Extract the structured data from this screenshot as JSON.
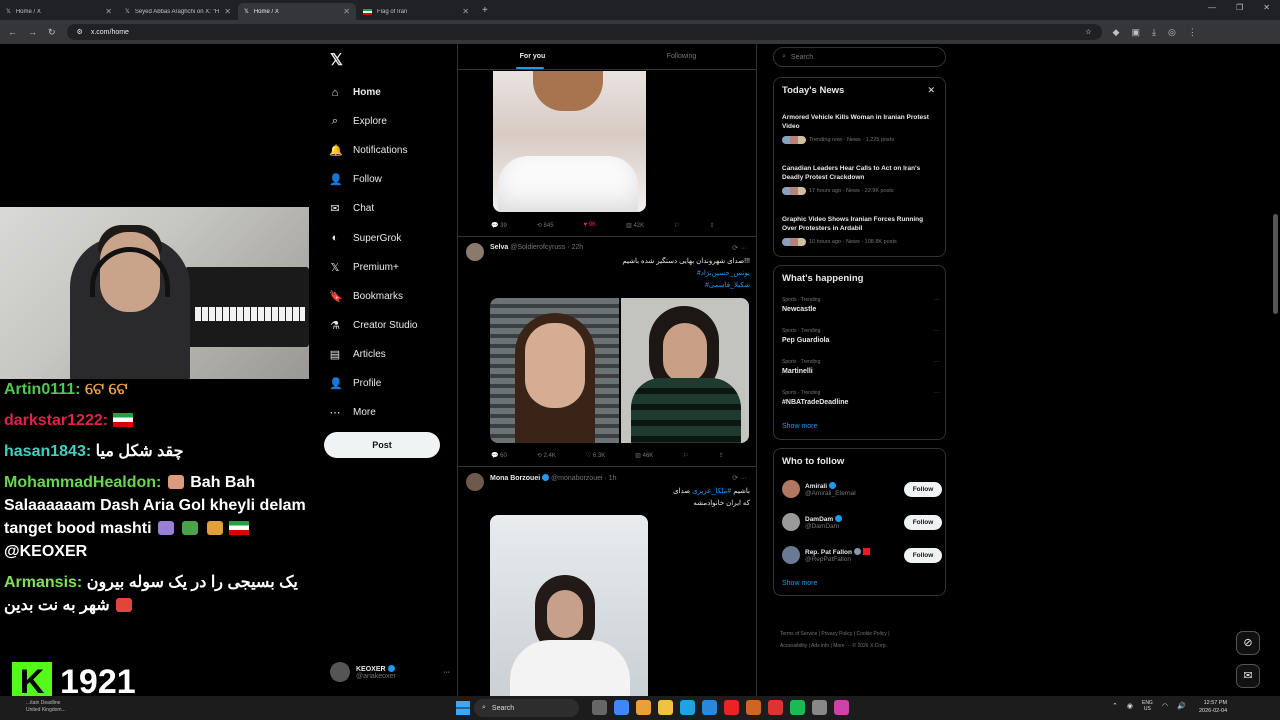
{
  "browser": {
    "tabs": [
      {
        "title": "Home / X",
        "active": false
      },
      {
        "title": "Seyed Abbas Araghchi on X: \"H",
        "active": false
      },
      {
        "title": "Home / X",
        "active": true
      },
      {
        "title": "Flag of Iran",
        "active": false
      }
    ],
    "url": "x.com/home"
  },
  "stream": {
    "chat": [
      {
        "user": "Artin0111:",
        "text": "ଟେ ଟେ"
      },
      {
        "user": "darkstar1222:",
        "text": ""
      },
      {
        "user": "hasan1843:",
        "text": "چقد شکل میا"
      },
      {
        "user": "MohammadHealdon:",
        "text": "Bah Bah Salaaaaaam Dash Aria Gol kheyli delam tanget bood mashti",
        "mention": "@KEOXER"
      },
      {
        "user": "Armansis:",
        "text": "یک بسیجی را در یک سوله بیرون شهر به نت بدین"
      }
    ],
    "viewer_count": "1921",
    "kick_logo": "K",
    "tasknote": [
      "...itain Deadline",
      "United Kingdom..."
    ]
  },
  "nav": {
    "items": [
      {
        "label": "Home",
        "icon": "home-icon",
        "glyph": "⌂"
      },
      {
        "label": "Explore",
        "icon": "search-icon",
        "glyph": "⌕"
      },
      {
        "label": "Notifications",
        "icon": "bell-icon",
        "glyph": "🔔"
      },
      {
        "label": "Follow",
        "icon": "person-plus-icon",
        "glyph": "👤"
      },
      {
        "label": "Chat",
        "icon": "chat-icon",
        "glyph": "✉"
      },
      {
        "label": "SuperGrok",
        "icon": "grok-icon",
        "glyph": "◐"
      },
      {
        "label": "Premium+",
        "icon": "x-premium-icon",
        "glyph": "𝕏"
      },
      {
        "label": "Bookmarks",
        "icon": "bookmark-icon",
        "glyph": "🔖"
      },
      {
        "label": "Creator Studio",
        "icon": "creator-icon",
        "glyph": "⚗"
      },
      {
        "label": "Articles",
        "icon": "article-icon",
        "glyph": "▤"
      },
      {
        "label": "Profile",
        "icon": "profile-icon",
        "glyph": "👤"
      },
      {
        "label": "More",
        "icon": "more-icon",
        "glyph": "⋯"
      }
    ],
    "post_label": "Post",
    "account": {
      "name": "KEOXER",
      "handle": "@ariakeoxer"
    }
  },
  "feed": {
    "tabs": [
      "For you",
      "Following"
    ],
    "post0": {
      "replies": "39",
      "reposts": "845",
      "likes": "9K",
      "views": "42K"
    },
    "post1": {
      "name": "Selva",
      "handle": "@Soldierofcyruss",
      "time": "· 22h",
      "text": "صدای شهروندان بهایی دستگیر شده باشیم!!!",
      "tags": [
        "#یونس_حسین‌نژاد",
        "#شکیلا_قاسمی"
      ],
      "replies": "60",
      "reposts": "2.4K",
      "likes": "6.3K",
      "views": "46K"
    },
    "post2": {
      "name": "Mona Borzouei",
      "handle": "@monaborzouei",
      "time": "· 1h",
      "text_pre": "صدای",
      "tag": "#ملکا_عزیزی",
      "text_post": "باشیم",
      "text2": "که ایران خانوادمشه"
    }
  },
  "right": {
    "search_placeholder": "Search",
    "news_title": "Today's News",
    "news": [
      {
        "title": "Armored Vehicle Kills Woman in Iranian Protest Video",
        "meta": "Trending now · News · 1,225 posts"
      },
      {
        "title": "Canadian Leaders Hear Calls to Act on Iran's Deadly Protest Crackdown",
        "meta": "17 hours ago · News · 22.9K posts"
      },
      {
        "title": "Graphic Video Shows Iranian Forces Running Over Protesters in Ardabil",
        "meta": "10 hours ago · News · 108.8K posts"
      }
    ],
    "happening_title": "What's happening",
    "trends": [
      {
        "context": "Sports · Trending",
        "name": "Newcastle"
      },
      {
        "context": "Sports · Trending",
        "name": "Pep Guardiola"
      },
      {
        "context": "Sports · Trending",
        "name": "Martinelli"
      },
      {
        "context": "Sports · Trending",
        "name": "#NBATradeDeadline"
      }
    ],
    "show_more": "Show more",
    "wtf_title": "Who to follow",
    "follow_label": "Follow",
    "who_to_follow": [
      {
        "name": "Amirali",
        "handle": "@Amirali_Eternal"
      },
      {
        "name": "DamDam",
        "handle": "@DamDam"
      },
      {
        "name": "Rep. Pat Fallon",
        "handle": "@RepPatFallon"
      }
    ],
    "footer": [
      "Terms of Service",
      "Privacy Policy",
      "Cookie Policy",
      "Accessibility",
      "Ads info",
      "More ···",
      "© 2026 X Corp."
    ]
  },
  "taskbar": {
    "search": "Search",
    "lang": "ENG",
    "region": "US",
    "time": "12:57 PM",
    "date": "2026-02-04"
  },
  "colors": {
    "accent": "#1d9bf0",
    "like": "#f91880",
    "kick": "#53fc18"
  }
}
